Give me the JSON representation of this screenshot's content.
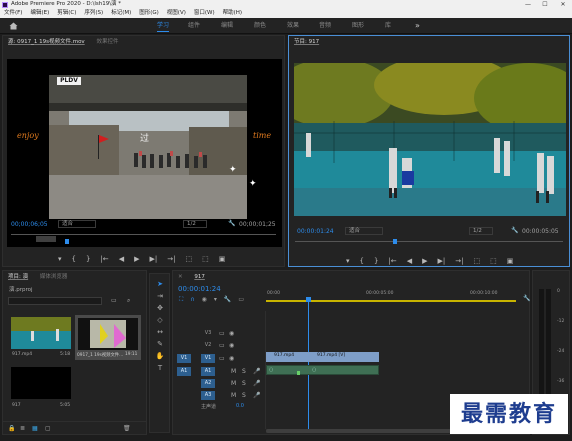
{
  "window": {
    "title": "Adobe Premiere Pro 2020 - D:\\lsh19\\演 *",
    "minimize": "—",
    "maximize": "☐",
    "close": "✕"
  },
  "menu": [
    "文件(F)",
    "编辑(E)",
    "剪辑(C)",
    "序列(S)",
    "标记(M)",
    "图形(G)",
    "视图(V)",
    "窗口(W)",
    "帮助(H)"
  ],
  "workspaces": {
    "home_icon": "home-icon",
    "tabs": [
      "学习",
      "组件",
      "编辑",
      "颜色",
      "效果",
      "音频",
      "图形",
      "库"
    ],
    "active": "学习",
    "more": "»"
  },
  "source": {
    "tab_source": "源: 0917_1 19s视频文件.mov",
    "tab_effects": "效果控件",
    "timecode": "00;00;06;05",
    "fit": "适合",
    "res": "1/2",
    "duration": "00;00;01;25",
    "overlay_top": "PLDV",
    "overlay_left": "enjoy",
    "overlay_mid": "过",
    "overlay_right": "time"
  },
  "program": {
    "tab": "节目: 917",
    "timecode": "00:00:01:24",
    "fit": "适合",
    "res": "1/2",
    "duration": "00:00:05:05"
  },
  "transport": [
    "{",
    "}",
    "|←",
    "◀",
    "▶",
    "▶|",
    "→|",
    "⬚",
    "⬚",
    "▣"
  ],
  "project": {
    "tab_project": "项目: 演",
    "tab_media": "媒体浏览器",
    "file": "演.prproj",
    "search_placeholder": "",
    "items": [
      {
        "name": "917.mp4",
        "duration": "5:18"
      },
      {
        "name": "0917_1 19s视频文件...",
        "duration": "19:11"
      },
      {
        "name": "917",
        "duration": "5:05"
      }
    ]
  },
  "timeline": {
    "tab": "917",
    "timecode": "00:00:01:24",
    "ruler": [
      "00:00",
      "00:00:05:00",
      "00:00:10:00"
    ],
    "video_tracks": [
      "V3",
      "V2",
      "V1"
    ],
    "audio_tracks": [
      "A1",
      "A2",
      "A3"
    ],
    "master": "主声道",
    "master_value": "0.0",
    "clips": [
      {
        "label": "917.mp4",
        "color": "#7e9ec8"
      },
      {
        "label": "917.mp4 [V]",
        "color": "#7e9ec8"
      }
    ],
    "meter_labels": [
      "0",
      "-12",
      "-24",
      "-36",
      "-48",
      "dB"
    ],
    "meter_bottom": "S S"
  },
  "watermark": "最需教育",
  "colors": {
    "accent": "#2d8ceb",
    "clip_video": "#7e9ec8",
    "clip_audio": "#3f6f54",
    "playhead": "#2d8ceb"
  }
}
